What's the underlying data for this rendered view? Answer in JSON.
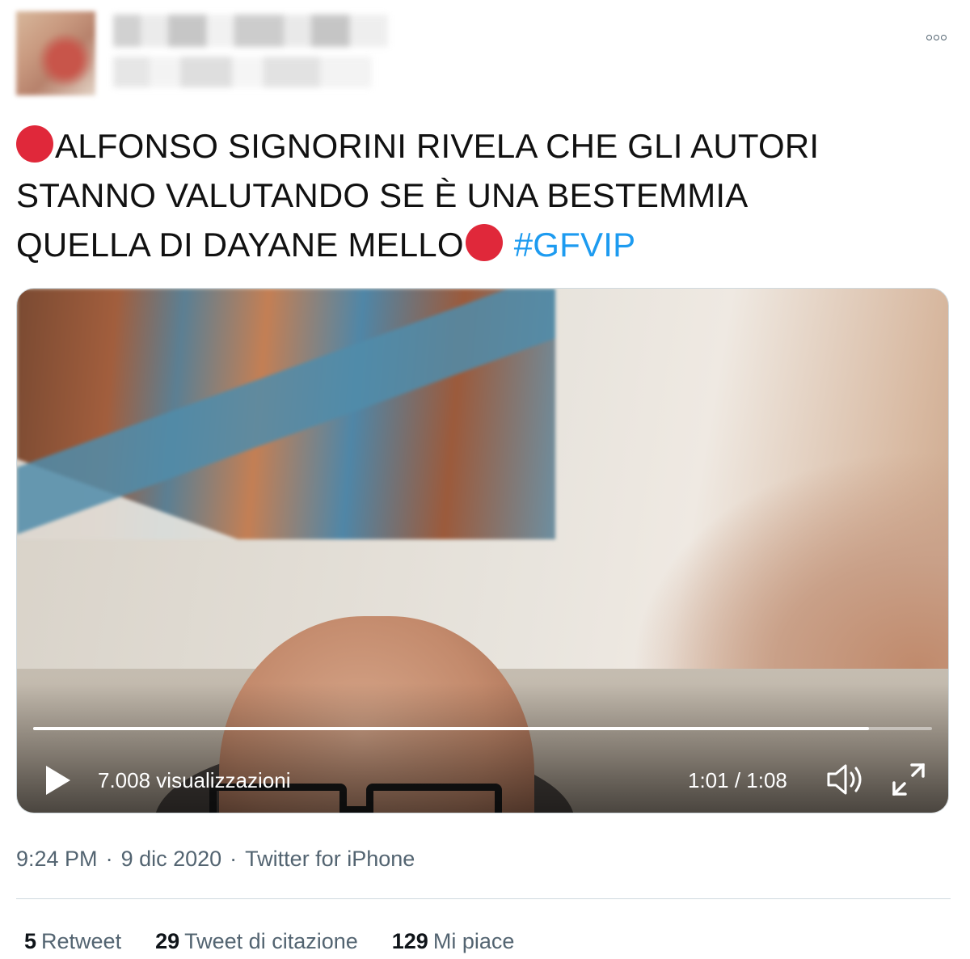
{
  "tweet": {
    "text_line1": "ALFONSO SIGNORINI RIVELA CHE GLI AUTORI",
    "text_line2": "STANNO VALUTANDO SE È UNA BESTEMMIA",
    "text_line3": "QUELLA DI DAYANE MELLO",
    "hashtag": "#GFVIP",
    "emoji": "red-circle"
  },
  "video": {
    "views": "7.008 visualizzazioni",
    "time": "1:01 / 1:08",
    "progress": 0.93
  },
  "meta": {
    "time": "9:24 PM",
    "date": "9 dic 2020",
    "separator": "·",
    "source": "Twitter for iPhone"
  },
  "stats": {
    "retweets_count": "5",
    "retweets_label": "Retweet",
    "quotes_count": "29",
    "quotes_label": "Tweet di citazione",
    "likes_count": "129",
    "likes_label": "Mi piace"
  },
  "colors": {
    "link": "#1d9bf0",
    "emoji_red": "#e0283a",
    "muted": "#536471"
  }
}
